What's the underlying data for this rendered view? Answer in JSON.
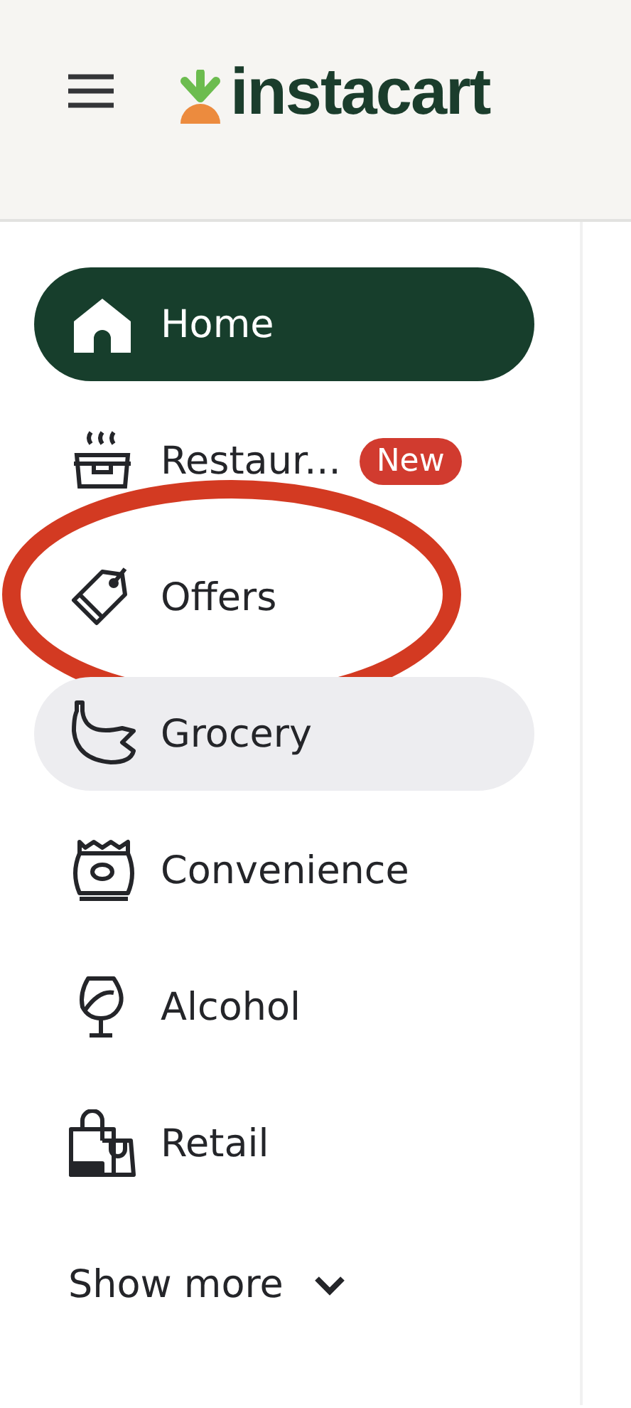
{
  "header": {
    "logo": "instacart"
  },
  "nav": {
    "items": [
      {
        "label": "Home",
        "selected": true,
        "hovered": false,
        "circled": false
      },
      {
        "label": "Restaur...",
        "badge": "New",
        "selected": false,
        "hovered": false,
        "circled": false
      },
      {
        "label": "Offers",
        "selected": false,
        "hovered": false,
        "circled": true
      },
      {
        "label": "Grocery",
        "selected": false,
        "hovered": true,
        "circled": false
      },
      {
        "label": "Convenience",
        "selected": false,
        "hovered": false,
        "circled": false
      },
      {
        "label": "Alcohol",
        "selected": false,
        "hovered": false,
        "circled": false
      },
      {
        "label": "Retail",
        "selected": false,
        "hovered": false,
        "circled": false
      }
    ],
    "show_more": "Show more"
  }
}
